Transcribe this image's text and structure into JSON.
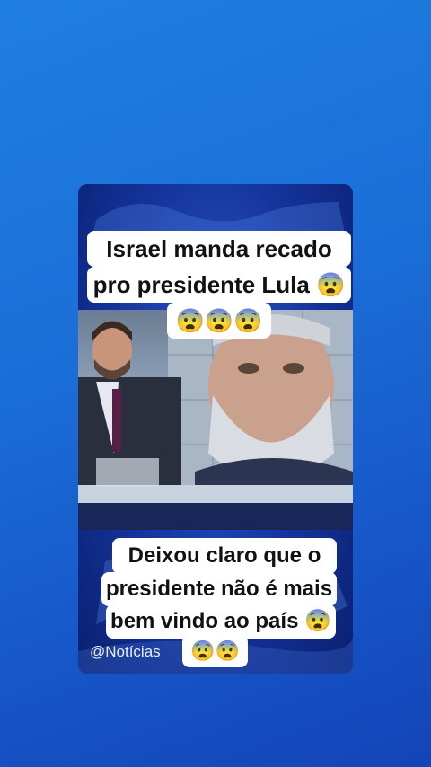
{
  "caption_top": {
    "line1": "Israel manda recado",
    "line2": "pro presidente Lula 😨",
    "line3": "😨😨😨"
  },
  "caption_bottom": {
    "line1": "Deixou claro que o",
    "line2": "presidente não é mais",
    "line3": "bem vindo ao país 😨",
    "line4": "😨😨"
  },
  "watermark": "@Notícias",
  "colors": {
    "background_top": "#1f7fe0",
    "background_bottom": "#1344b8",
    "caption_bg": "#ffffff",
    "caption_text": "#111111"
  }
}
